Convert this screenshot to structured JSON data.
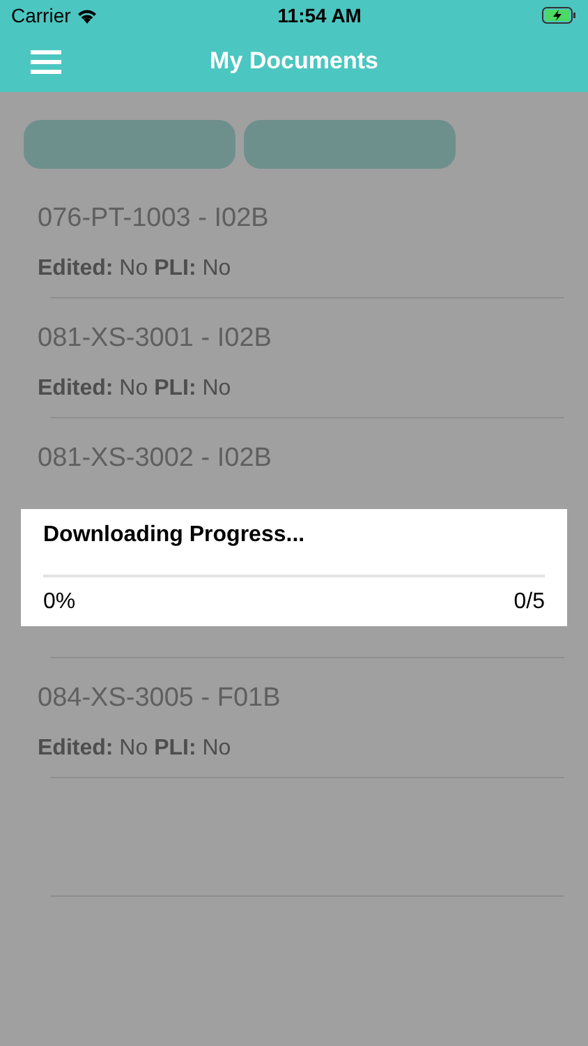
{
  "status_bar": {
    "carrier": "Carrier",
    "time": "11:54 AM"
  },
  "header": {
    "title": "My Documents"
  },
  "action_buttons": [
    {
      "kind": "button"
    },
    {
      "kind": "button"
    }
  ],
  "documents": [
    {
      "kind": "document",
      "title": "076-PT-1003 - I02B",
      "meta": "**Edited:** No **PLI:** No"
    },
    {
      "kind": "document",
      "title": "081-XS-3001 - I02B",
      "meta": "**Edited:** No **PLI:** No"
    },
    {
      "kind": "document",
      "title": "081-XS-3002 - I02B"
    },
    {
      "kind": "covered"
    },
    {
      "kind": "document",
      "title": "084-XS-3005 - F01B",
      "meta": "**Edited:** No **PLI:** No"
    }
  ],
  "progress_dialog": {
    "title": "Downloading Progress...",
    "level": 0,
    "percent": "0%",
    "count": "0/5"
  }
}
